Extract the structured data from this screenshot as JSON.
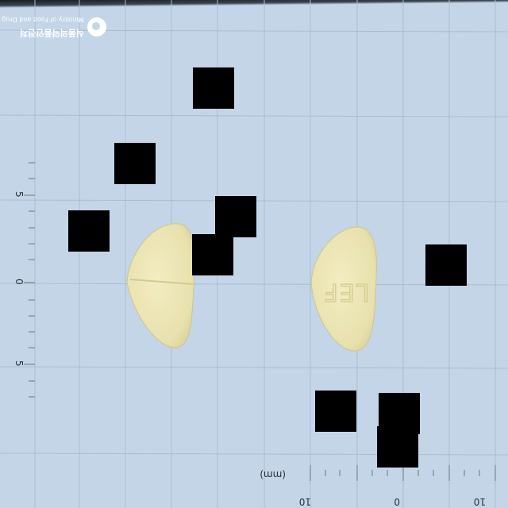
{
  "logo": {
    "org_name_en": "Ministry of Food and Drug Safety",
    "org_name_ko": "식품의약품안전처"
  },
  "ruler": {
    "vertical_labels": [
      "5",
      "0",
      "5"
    ],
    "horizontal_labels": [
      "10",
      "0",
      "10"
    ],
    "unit": "(mm)"
  },
  "pills": {
    "front_imprint": "",
    "back_imprint": "LEF"
  },
  "colors": {
    "background": "#c4d5e7",
    "grid": "#a9bed2",
    "pill": "#ece6b4",
    "redaction": "#000000"
  }
}
